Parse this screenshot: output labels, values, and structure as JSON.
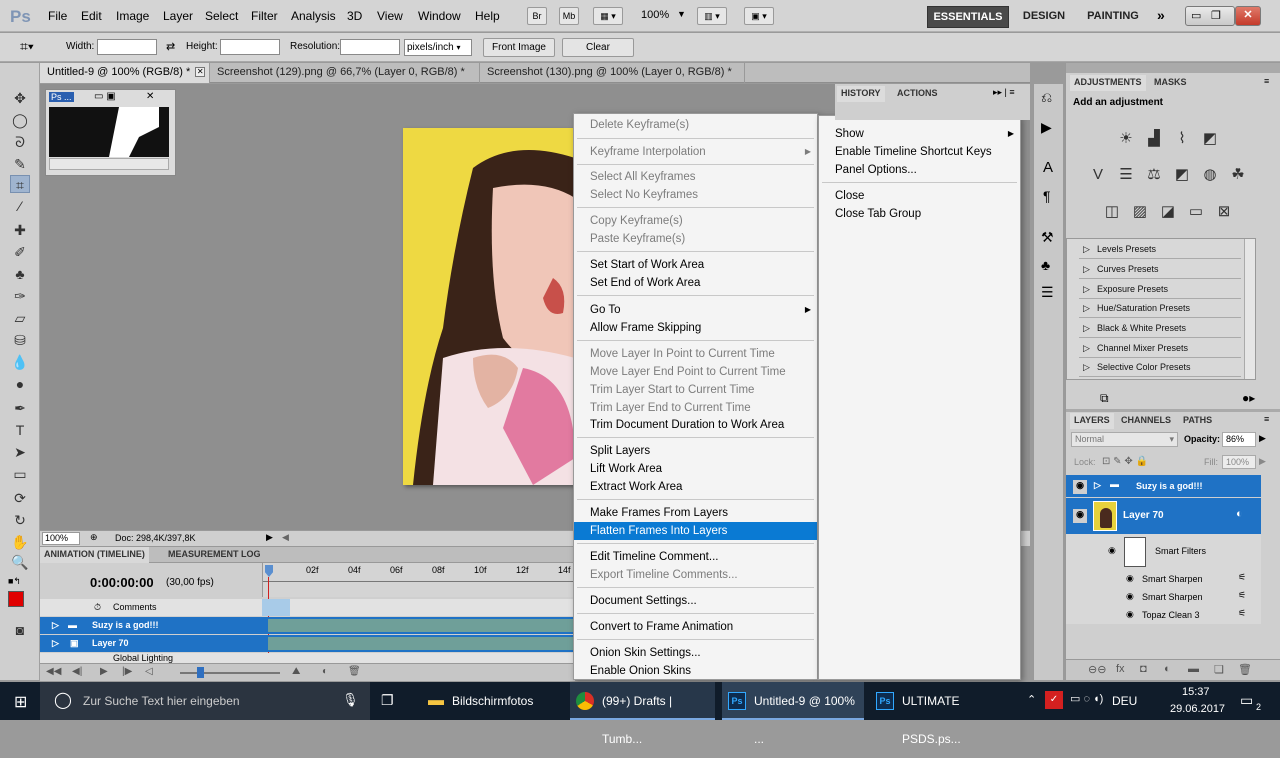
{
  "app": {
    "logo": "Ps"
  },
  "menu": [
    "File",
    "Edit",
    "Image",
    "Layer",
    "Select",
    "Filter",
    "Analysis",
    "3D",
    "View",
    "Window",
    "Help"
  ],
  "menubar": {
    "zoom": "100%",
    "br_label": "Br",
    "mb_label": "Mb"
  },
  "workspaces": [
    "ESSENTIALS",
    "DESIGN",
    "PAINTING"
  ],
  "options": {
    "width_label": "Width:",
    "height_label": "Height:",
    "resolution_label": "Resolution:",
    "unit": "pixels/inch",
    "front_image": "Front Image",
    "clear": "Clear"
  },
  "tabs": [
    "Untitled-9 @ 100% (RGB/8) *",
    "Screenshot (129).png @ 66,7% (Layer 0, RGB/8) *",
    "Screenshot (130).png @ 100% (Layer 0, RGB/8) *"
  ],
  "navigator": {
    "title": "Ps ..."
  },
  "status": {
    "zoom": "100%",
    "doc": "Doc: 298,4K/397,8K"
  },
  "timeline": {
    "tabs": [
      "ANIMATION (TIMELINE)",
      "MEASUREMENT LOG"
    ],
    "time": "0:00:00:00",
    "fps": "(30,00 fps)",
    "ruler": [
      "02f",
      "04f",
      "06f",
      "08f",
      "10f",
      "12f",
      "14f"
    ],
    "rows": [
      "Comments",
      "Suzy is a god!!!",
      "Layer 70",
      "Global Lighting"
    ]
  },
  "context_menu": {
    "items": [
      {
        "label": "Delete Keyframe(s)",
        "disabled": true
      },
      {
        "label": "Keyframe Interpolation",
        "disabled": true,
        "submenu": true
      },
      {
        "label": "Select All Keyframes",
        "disabled": true
      },
      {
        "label": "Select No Keyframes",
        "disabled": true
      },
      {
        "label": "Copy Keyframe(s)",
        "disabled": true
      },
      {
        "label": "Paste Keyframe(s)",
        "disabled": true
      },
      {
        "label": "Set Start of Work Area",
        "disabled": false
      },
      {
        "label": "Set End of Work Area",
        "disabled": false
      },
      {
        "label": "Go To",
        "disabled": false,
        "submenu": true
      },
      {
        "label": "Allow Frame Skipping",
        "disabled": false
      },
      {
        "label": "Move Layer In Point to Current Time",
        "disabled": true
      },
      {
        "label": "Move Layer End Point to Current Time",
        "disabled": true
      },
      {
        "label": "Trim Layer Start to Current Time",
        "disabled": true
      },
      {
        "label": "Trim Layer End to Current Time",
        "disabled": true
      },
      {
        "label": "Trim Document Duration to Work Area",
        "disabled": false
      },
      {
        "label": "Split Layers",
        "disabled": false
      },
      {
        "label": "Lift Work Area",
        "disabled": false
      },
      {
        "label": "Extract Work Area",
        "disabled": false
      },
      {
        "label": "Make Frames From Layers",
        "disabled": false
      },
      {
        "label": "Flatten Frames Into Layers",
        "disabled": false,
        "highlighted": true
      },
      {
        "label": "Edit Timeline Comment...",
        "disabled": false
      },
      {
        "label": "Export Timeline Comments...",
        "disabled": true
      },
      {
        "label": "Document Settings...",
        "disabled": false
      },
      {
        "label": "Convert to Frame Animation",
        "disabled": false
      },
      {
        "label": "Onion Skin Settings...",
        "disabled": false
      },
      {
        "label": "Enable Onion Skins",
        "disabled": false
      }
    ]
  },
  "panel_menu": {
    "items": [
      "Show",
      "Enable Timeline Shortcut Keys",
      "Panel Options...",
      "Close",
      "Close Tab Group"
    ]
  },
  "history": {
    "tabs": [
      "HISTORY",
      "ACTIONS"
    ]
  },
  "adjustments": {
    "tabs": [
      "ADJUSTMENTS",
      "MASKS"
    ],
    "title": "Add an adjustment",
    "presets": [
      "Levels Presets",
      "Curves Presets",
      "Exposure Presets",
      "Hue/Saturation Presets",
      "Black & White Presets",
      "Channel Mixer Presets",
      "Selective Color Presets"
    ]
  },
  "layers": {
    "tabs": [
      "LAYERS",
      "CHANNELS",
      "PATHS"
    ],
    "blend": "Normal",
    "opacity_label": "Opacity:",
    "opacity": "86%",
    "lock_label": "Lock:",
    "fill_label": "Fill:",
    "fill": "100%",
    "items": [
      {
        "name": "Suzy is a god!!!",
        "type": "group"
      },
      {
        "name": "Layer 70",
        "type": "layer"
      },
      {
        "name": "Smart Filters",
        "type": "filters"
      },
      {
        "name": "Smart Sharpen",
        "type": "filter"
      },
      {
        "name": "Smart Sharpen",
        "type": "filter"
      },
      {
        "name": "Topaz Clean 3",
        "type": "filter"
      }
    ]
  },
  "taskbar": {
    "search": "Zur Suche Text hier eingeben",
    "apps": [
      "Bildschirmfotos",
      "(99+) Drafts | Tumb...",
      "Untitled-9 @ 100% ...",
      "ULTIMATE PSDS.ps..."
    ],
    "lang": "DEU",
    "time": "15:37",
    "date": "29.06.2017",
    "notif": "2"
  },
  "colors": {
    "highlight": "#0a7ad3",
    "layer_selected": "#1f72c5",
    "taskbar": "#101c2a"
  }
}
